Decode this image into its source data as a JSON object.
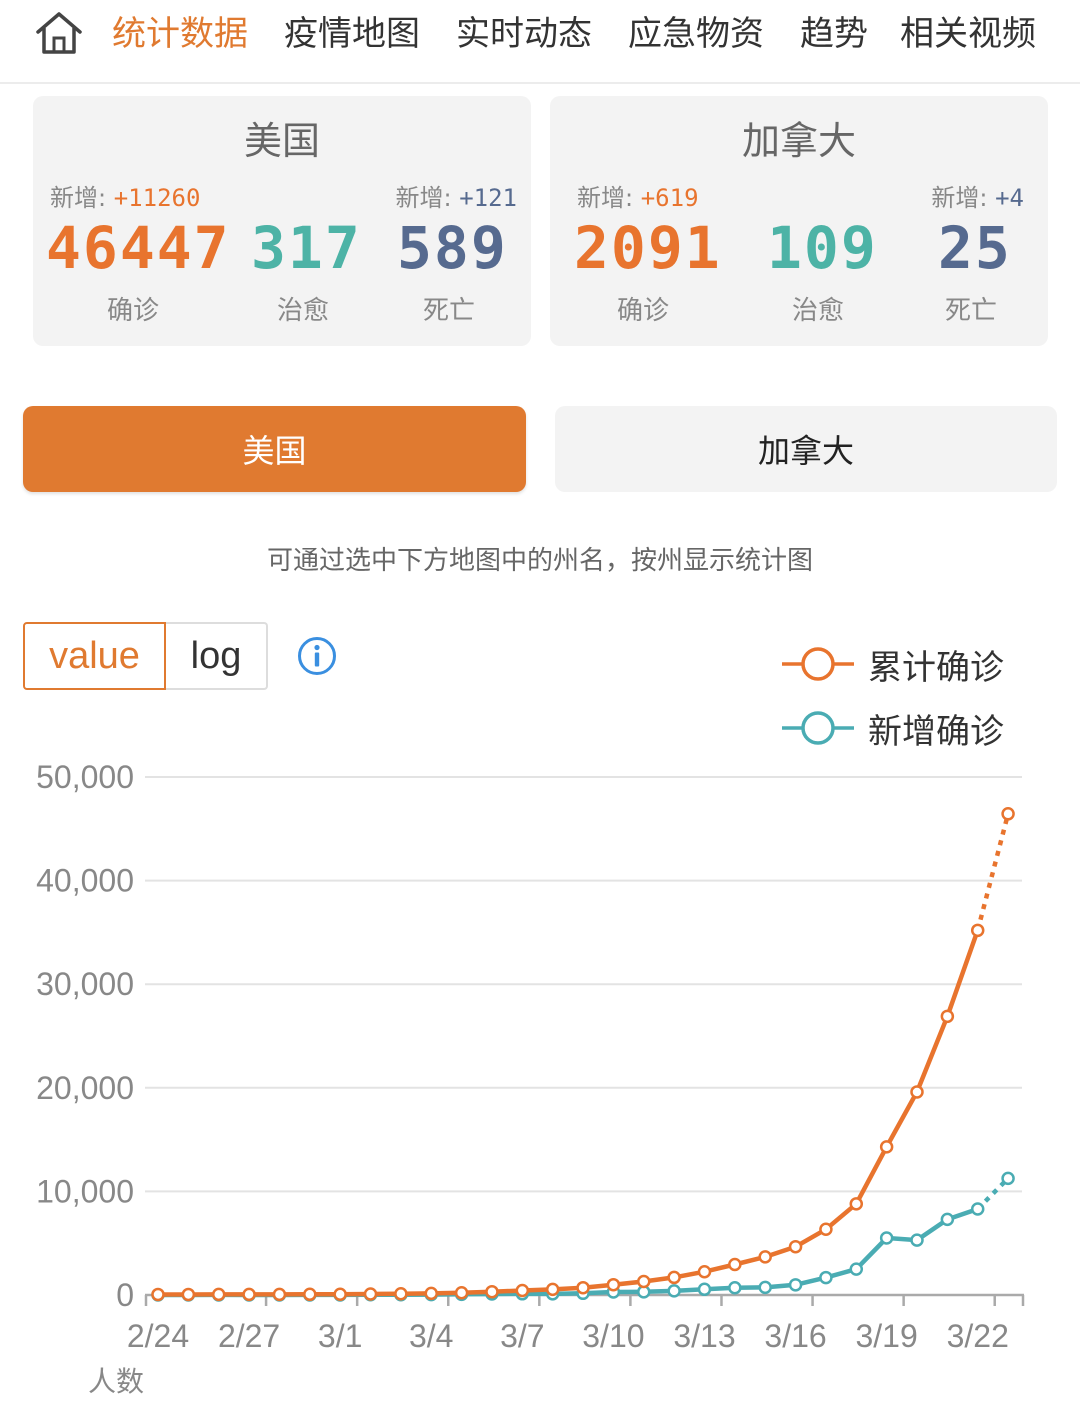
{
  "nav": {
    "home_icon": "home-icon",
    "items": [
      {
        "label": "统计数据",
        "active": true
      },
      {
        "label": "疫情地图",
        "active": false
      },
      {
        "label": "实时动态",
        "active": false
      },
      {
        "label": "应急物资",
        "active": false
      },
      {
        "label": "趋势",
        "active": false
      },
      {
        "label": "相关视频",
        "active": false
      }
    ]
  },
  "cards": [
    {
      "country": "美国",
      "new_prefix": "新增: ",
      "new_confirmed": "+11260",
      "new_deaths": "+121",
      "confirmed": "46447",
      "recovered": "317",
      "deaths": "589",
      "confirmed_label": "确诊",
      "recovered_label": "治愈",
      "deaths_label": "死亡"
    },
    {
      "country": "加拿大",
      "new_prefix": "新增: ",
      "new_confirmed": "+619",
      "new_deaths": "+4",
      "confirmed": "2091",
      "recovered": "109",
      "deaths": "25",
      "confirmed_label": "确诊",
      "recovered_label": "治愈",
      "deaths_label": "死亡"
    }
  ],
  "country_tabs": [
    {
      "label": "美国",
      "active": true
    },
    {
      "label": "加拿大",
      "active": false
    }
  ],
  "hint": "可通过选中下方地图中的州名，按州显示统计图",
  "scale_toggle": {
    "value_label": "value",
    "log_label": "log",
    "selected": "value"
  },
  "info_icon": "info-icon",
  "colors": {
    "accent": "#e07a30",
    "confirmed": "#e8742e",
    "recovered": "#4db3a6",
    "deaths": "#566a8f",
    "new_series": "#4aacb3"
  },
  "chart_data": {
    "type": "line",
    "ylabel": "人数",
    "ylim": [
      0,
      50000
    ],
    "yticks": [
      "0",
      "10,000",
      "20,000",
      "30,000",
      "40,000",
      "50,000"
    ],
    "x_tick_labels": [
      "2/24",
      "2/27",
      "3/1",
      "3/4",
      "3/7",
      "3/10",
      "3/13",
      "3/16",
      "3/19",
      "3/22"
    ],
    "x": [
      "2/24",
      "2/25",
      "2/26",
      "2/27",
      "2/28",
      "2/29",
      "3/1",
      "3/2",
      "3/3",
      "3/4",
      "3/5",
      "3/6",
      "3/7",
      "3/8",
      "3/9",
      "3/10",
      "3/11",
      "3/12",
      "3/13",
      "3/14",
      "3/15",
      "3/16",
      "3/17",
      "3/18",
      "3/19",
      "3/20",
      "3/21",
      "3/22",
      "3/23"
    ],
    "legend_position": "top-right",
    "grid": true,
    "last_point_dotted": true,
    "series": [
      {
        "name": "累计确诊",
        "color": "#e8742e",
        "values": [
          53,
          53,
          59,
          60,
          62,
          68,
          74,
          100,
          124,
          158,
          221,
          319,
          435,
          541,
          704,
          994,
          1301,
          1697,
          2247,
          2943,
          3680,
          4663,
          6344,
          8800,
          14300,
          19600,
          26900,
          35200,
          46447
        ]
      },
      {
        "name": "新增确诊",
        "color": "#4aacb3",
        "values": [
          0,
          0,
          6,
          1,
          2,
          6,
          6,
          26,
          24,
          34,
          63,
          98,
          116,
          106,
          163,
          290,
          307,
          396,
          550,
          696,
          737,
          983,
          1681,
          2500,
          5500,
          5300,
          7300,
          8300,
          11260
        ]
      }
    ]
  }
}
